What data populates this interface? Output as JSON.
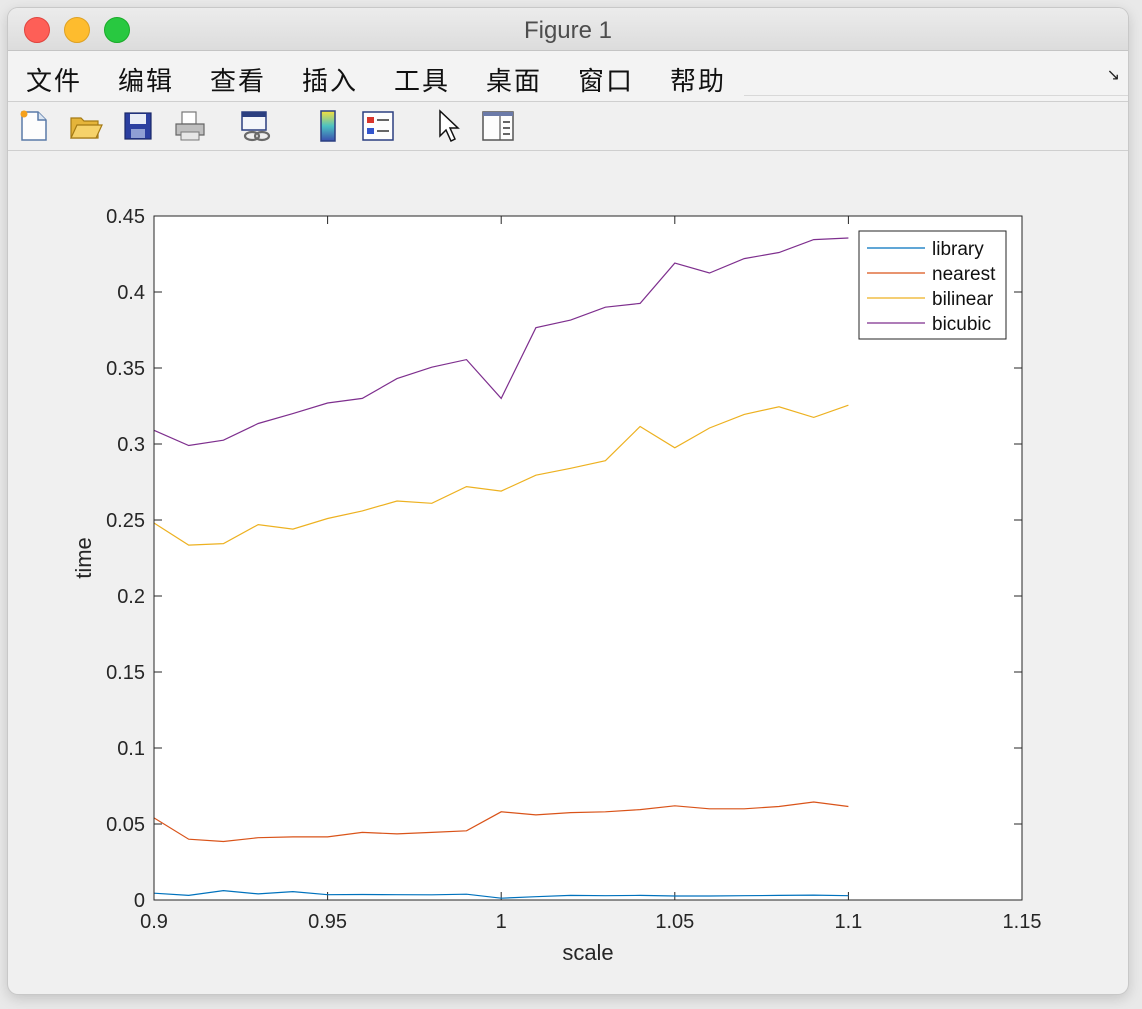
{
  "window": {
    "title": "Figure 1"
  },
  "menu": {
    "items": [
      "文件",
      "编辑",
      "查看",
      "插入",
      "工具",
      "桌面",
      "窗口",
      "帮助"
    ],
    "arrow_icon": "dock-arrow-icon"
  },
  "toolbar": {
    "tools": [
      {
        "name": "new-figure-icon"
      },
      {
        "name": "open-file-icon"
      },
      {
        "name": "save-icon"
      },
      {
        "name": "print-icon"
      },
      {
        "name": "link-plot-icon"
      },
      {
        "name": "insert-colorbar-icon"
      },
      {
        "name": "insert-legend-icon"
      },
      {
        "name": "edit-plot-pointer-icon"
      },
      {
        "name": "property-inspector-icon"
      }
    ]
  },
  "chart_data": {
    "type": "line",
    "xlabel": "scale",
    "ylabel": "time",
    "xlim": [
      0.9,
      1.15
    ],
    "ylim": [
      0,
      0.45
    ],
    "xticks": [
      "0.9",
      "0.95",
      "1",
      "1.05",
      "1.1",
      "1.15"
    ],
    "yticks": [
      "0",
      "0.05",
      "0.1",
      "0.15",
      "0.2",
      "0.25",
      "0.3",
      "0.35",
      "0.4",
      "0.45"
    ],
    "legend_position": "top-right",
    "x": [
      0.9,
      0.91,
      0.92,
      0.93,
      0.94,
      0.95,
      0.96,
      0.97,
      0.98,
      0.99,
      1.0,
      1.01,
      1.02,
      1.03,
      1.04,
      1.05,
      1.06,
      1.07,
      1.08,
      1.09,
      1.1
    ],
    "series": [
      {
        "name": "library",
        "color": "#0072bd",
        "values": [
          0.0045,
          0.003,
          0.0062,
          0.004,
          0.0055,
          0.0035,
          0.0036,
          0.0035,
          0.0034,
          0.0038,
          0.0012,
          0.0022,
          0.003,
          0.0028,
          0.003,
          0.0026,
          0.0026,
          0.0028,
          0.003,
          0.0032,
          0.0028
        ]
      },
      {
        "name": "nearest",
        "color": "#d95319",
        "values": [
          0.054,
          0.04,
          0.0385,
          0.041,
          0.0415,
          0.0415,
          0.0445,
          0.0435,
          0.0445,
          0.0455,
          0.058,
          0.056,
          0.0575,
          0.058,
          0.0595,
          0.062,
          0.06,
          0.06,
          0.0615,
          0.0645,
          0.0615
        ]
      },
      {
        "name": "bilinear",
        "color": "#edb120",
        "values": [
          0.248,
          0.2335,
          0.2345,
          0.247,
          0.244,
          0.251,
          0.256,
          0.2625,
          0.261,
          0.272,
          0.269,
          0.2795,
          0.284,
          0.289,
          0.3115,
          0.2975,
          0.3105,
          0.3195,
          0.3245,
          0.3175,
          0.3255
        ]
      },
      {
        "name": "bicubic",
        "color": "#7e2f8e",
        "values": [
          0.309,
          0.299,
          0.3025,
          0.3135,
          0.32,
          0.327,
          0.33,
          0.343,
          0.3505,
          0.3555,
          0.33,
          0.3765,
          0.3815,
          0.39,
          0.3925,
          0.419,
          0.4125,
          0.422,
          0.426,
          0.4345,
          0.4355
        ]
      }
    ]
  }
}
